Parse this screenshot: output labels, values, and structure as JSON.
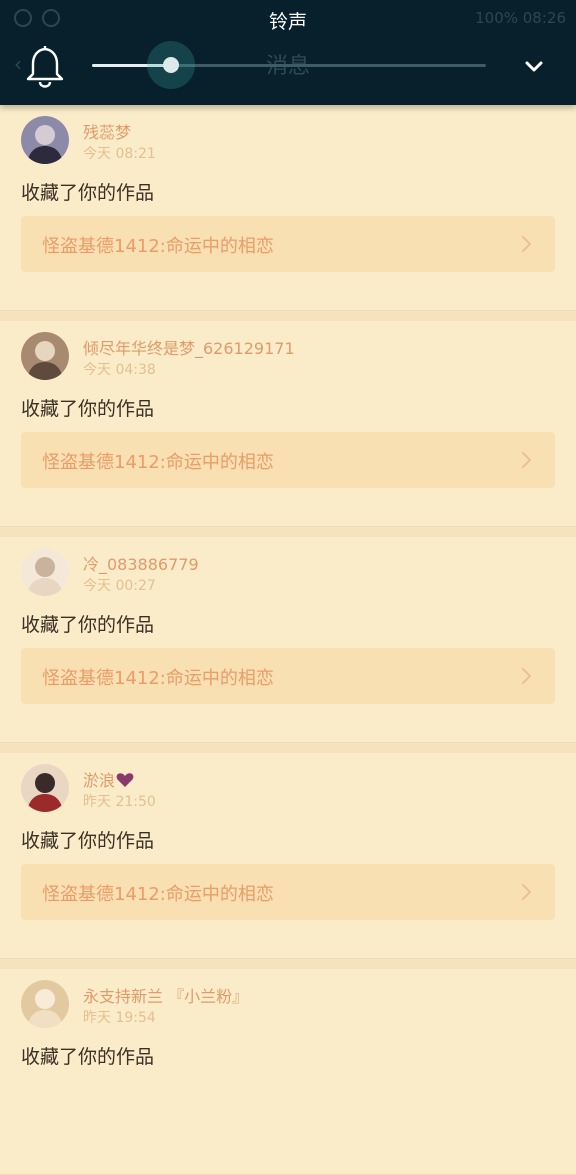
{
  "volume_panel": {
    "title": "铃声",
    "level": 0.2,
    "header_title": "消息"
  },
  "status_bar": {
    "text": "100%  08:26"
  },
  "feed": [
    {
      "user": "残蕊梦",
      "heart": false,
      "time": "今天  08:21",
      "action": "收藏了你的作品",
      "work_title": "怪盗基德1412:命运中的相恋",
      "avatar_colors": [
        "#2c2a3c",
        "#8c8aa8",
        "#d5cbd2"
      ]
    },
    {
      "user": "倾尽年华终是梦_626129171",
      "heart": false,
      "time": "今天  04:38",
      "action": "收藏了你的作品",
      "work_title": "怪盗基德1412:命运中的相恋",
      "avatar_colors": [
        "#5f4a3c",
        "#a88a70",
        "#e6d5bf"
      ]
    },
    {
      "user": "冷_083886779",
      "heart": false,
      "time": "今天  00:27",
      "action": "收藏了你的作品",
      "work_title": "怪盗基德1412:命运中的相恋",
      "avatar_colors": [
        "#e8d6c2",
        "#f4e8d8",
        "#c9b39c"
      ]
    },
    {
      "user": "淤浪",
      "heart": true,
      "time": "昨天  21:50",
      "action": "收藏了你的作品",
      "work_title": "怪盗基德1412:命运中的相恋",
      "avatar_colors": [
        "#9b2a2a",
        "#e9d7c4",
        "#3a2a2a"
      ]
    },
    {
      "user": "永支持新兰 『小兰粉』",
      "heart": false,
      "time": "昨天  19:54",
      "action": "收藏了你的作品",
      "work_title": "",
      "avatar_colors": [
        "#f0dfc3",
        "#e3c9a0",
        "#f8ecd8"
      ]
    }
  ],
  "colors": {
    "accent": "#ec9c67",
    "panel": "#07202b",
    "heart": "#8a3a6a"
  }
}
